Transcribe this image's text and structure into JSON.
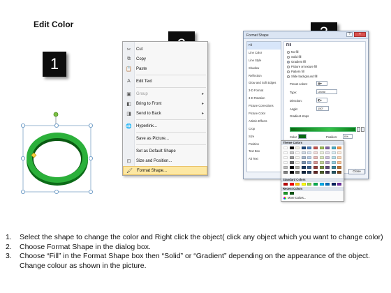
{
  "title": "Edit Color",
  "steps": {
    "one": "1",
    "two": "2",
    "three": "3"
  },
  "shape": {
    "ring_color": "#1f9a2c",
    "ring_dark": "#0b5a14",
    "handle_color": "#5ba0d0",
    "rotate_handle_color": "#7bc143"
  },
  "context_menu": {
    "items": [
      {
        "label": "Cut",
        "icon": "scissors-icon",
        "state": "normal",
        "submenu": false
      },
      {
        "label": "Copy",
        "icon": "copy-icon",
        "state": "normal",
        "submenu": false
      },
      {
        "label": "Paste",
        "icon": "paste-icon",
        "state": "normal",
        "submenu": false
      },
      {
        "label": "Edit Text",
        "icon": "edit-text-icon",
        "state": "normal",
        "submenu": false
      },
      {
        "label": "Group",
        "icon": "group-icon",
        "state": "disabled",
        "submenu": true
      },
      {
        "label": "Bring to Front",
        "icon": "bring-front-icon",
        "state": "normal",
        "submenu": true
      },
      {
        "label": "Send to Back",
        "icon": "send-back-icon",
        "state": "normal",
        "submenu": true
      },
      {
        "label": "Hyperlink...",
        "icon": "hyperlink-icon",
        "state": "normal",
        "submenu": false
      },
      {
        "label": "Save as Picture...",
        "icon": "",
        "state": "normal",
        "submenu": false
      },
      {
        "label": "Set as Default Shape",
        "icon": "",
        "state": "normal",
        "submenu": false
      },
      {
        "label": "Size and Position...",
        "icon": "size-position-icon",
        "state": "normal",
        "submenu": false
      },
      {
        "label": "Format Shape...",
        "icon": "format-shape-icon",
        "state": "selected",
        "submenu": false
      }
    ]
  },
  "dialog": {
    "title": "Format Shape",
    "categories": [
      "Fill",
      "Line Color",
      "Line Style",
      "Shadow",
      "Reflection",
      "Glow and Soft Edges",
      "3-D Format",
      "3-D Rotation",
      "Picture Corrections",
      "Picture Color",
      "Artistic Effects",
      "Crop",
      "Size",
      "Position",
      "Text Box",
      "Alt Text"
    ],
    "panel_heading": "Fill",
    "fill_options": [
      "No fill",
      "Solid fill",
      "Gradient fill",
      "Picture or texture fill",
      "Pattern fill",
      "Slide background fill"
    ],
    "selected_fill": "Gradient fill",
    "props": {
      "preset_label": "Preset colors:",
      "type_label": "Type:",
      "type_value": "Linear",
      "direction_label": "Direction:",
      "angle_label": "Angle:",
      "angle_value": "150°",
      "stops_label": "Gradient stops",
      "position_label": "Position:",
      "position_value": "0%",
      "color_label": "Color",
      "brightness_label": "Brightness:",
      "transparency_label": "Transpare",
      "rotate_label": "Rotate"
    },
    "close_label": "Close",
    "gradient_colors": [
      "#0a6a14",
      "#37c44a",
      "#0b7a1b"
    ]
  },
  "palette": {
    "theme_label": "Theme Colors",
    "standard_label": "Standard Colors",
    "recent_label": "Recent Colors",
    "more_label": "More Colors...",
    "theme_top": [
      "#ffffff",
      "#000000",
      "#eeece1",
      "#1f497d",
      "#4f81bd",
      "#c0504d",
      "#9bbb59",
      "#8064a2",
      "#4bacc6",
      "#f79646"
    ],
    "standard": [
      "#c00000",
      "#ff0000",
      "#ffc000",
      "#ffff00",
      "#92d050",
      "#00b050",
      "#00b0f0",
      "#0070c0",
      "#002060",
      "#7030a0"
    ],
    "recent": [
      "#1f9a2c",
      "#0b5a14"
    ]
  },
  "instructions": [
    {
      "num": "1.",
      "text": "Select the shape to change the color and Right click the object( click any object which you want to change color)"
    },
    {
      "num": "2.",
      "text": "Choose Format Shape in the dialog box."
    },
    {
      "num": "3.",
      "text": "Choose “Fill” in the Format Shape box then “Solid” or “Gradient” depending on the appearance of the object. Change colour as shown in the picture."
    }
  ]
}
